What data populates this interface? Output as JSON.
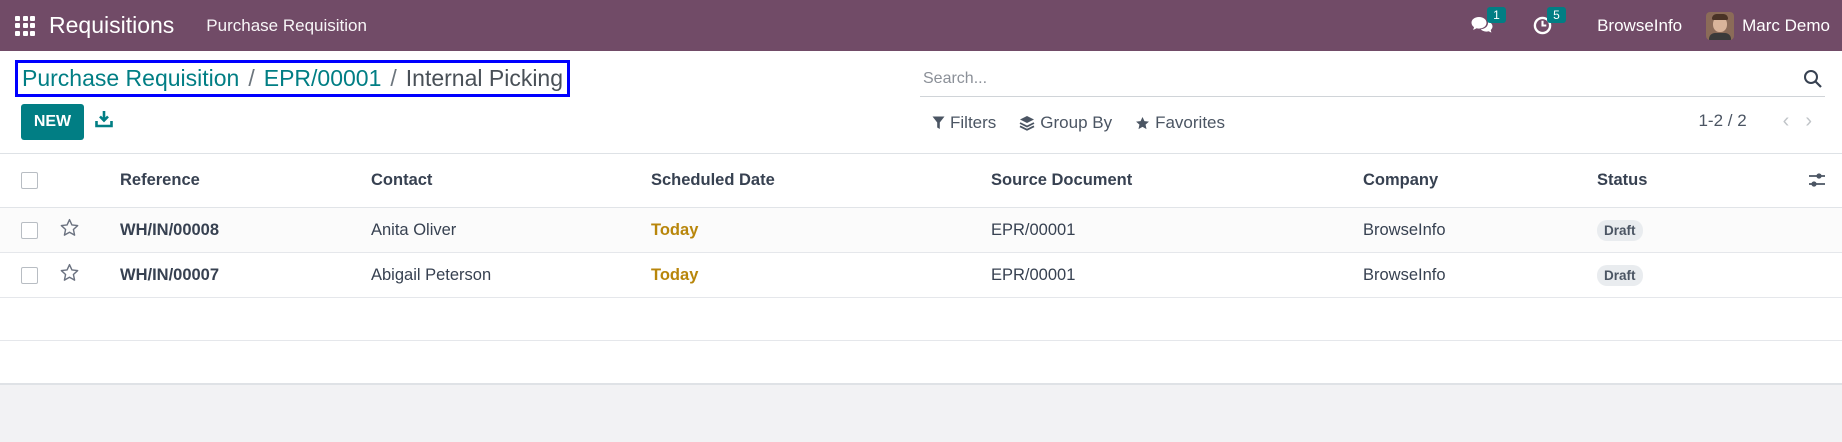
{
  "topbar": {
    "app_title": "Requisitions",
    "menu_item": "Purchase Requisition",
    "messages_count": "1",
    "activities_count": "5",
    "company": "BrowseInfo",
    "user_name": "Marc Demo"
  },
  "breadcrumb": {
    "items": [
      "Purchase Requisition",
      "EPR/00001"
    ],
    "current": "Internal Picking",
    "separator": "/"
  },
  "actions": {
    "new_label": "NEW"
  },
  "search": {
    "placeholder": "Search..."
  },
  "filters": {
    "filters_label": "Filters",
    "group_by_label": "Group By",
    "favorites_label": "Favorites"
  },
  "pager": {
    "value": "1-2 / 2"
  },
  "table": {
    "headers": [
      "Reference",
      "Contact",
      "Scheduled Date",
      "Source Document",
      "Company",
      "Status"
    ],
    "rows": [
      {
        "reference": "WH/IN/00008",
        "contact": "Anita Oliver",
        "scheduled": "Today",
        "source": "EPR/00001",
        "company": "BrowseInfo",
        "status": "Draft"
      },
      {
        "reference": "WH/IN/00007",
        "contact": "Abigail Peterson",
        "scheduled": "Today",
        "source": "EPR/00001",
        "company": "BrowseInfo",
        "status": "Draft"
      }
    ]
  },
  "colors": {
    "brand": "#714b67",
    "accent": "#017e84",
    "today": "#b8860b",
    "highlight_border": "#0000ff"
  }
}
